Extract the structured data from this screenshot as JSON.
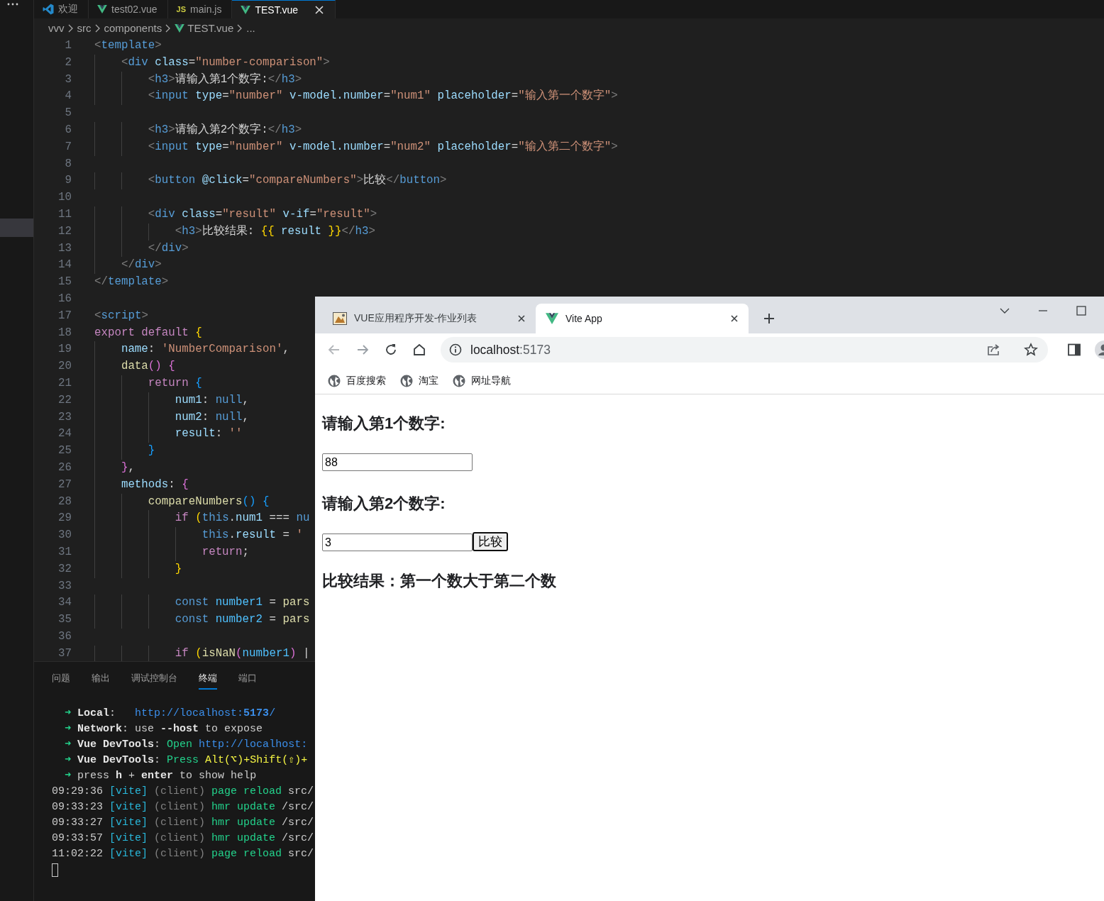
{
  "editor": {
    "tabs": [
      {
        "label": "欢迎",
        "kind": "welcome",
        "selected": false
      },
      {
        "label": "test02.vue",
        "kind": "vue",
        "selected": false
      },
      {
        "label": "main.js",
        "kind": "js",
        "icon_text": "JS",
        "selected": false
      },
      {
        "label": "TEST.vue",
        "kind": "vue",
        "selected": true
      }
    ],
    "breadcrumbs": [
      {
        "label": "vvv",
        "kind": "folder"
      },
      {
        "label": "src",
        "kind": "folder"
      },
      {
        "label": "components",
        "kind": "folder"
      },
      {
        "label": "TEST.vue",
        "kind": "vue"
      },
      {
        "label": "...",
        "kind": "more"
      }
    ],
    "code_lines": [
      {
        "number": "1",
        "tokens": [
          {
            "text": "<",
            "kind": "punct"
          },
          {
            "text": "template",
            "kind": "tag"
          },
          {
            "text": ">",
            "kind": "punct"
          }
        ]
      },
      {
        "number": "2",
        "tokens": [
          {
            "text": "    <",
            "kind": "punct"
          },
          {
            "text": "div",
            "kind": "tag"
          },
          {
            "text": " class",
            "kind": "attr"
          },
          {
            "text": "=",
            "kind": "text"
          },
          {
            "text": "\"number-comparison\"",
            "kind": "string"
          },
          {
            "text": ">",
            "kind": "punct"
          }
        ]
      },
      {
        "number": "3",
        "tokens": [
          {
            "text": "        <",
            "kind": "punct"
          },
          {
            "text": "h3",
            "kind": "tag"
          },
          {
            "text": ">",
            "kind": "punct"
          },
          {
            "text": "请输入第1个数字:",
            "kind": "text"
          },
          {
            "text": "</",
            "kind": "punct"
          },
          {
            "text": "h3",
            "kind": "tag"
          },
          {
            "text": ">",
            "kind": "punct"
          }
        ]
      },
      {
        "number": "4",
        "tokens": [
          {
            "text": "        <",
            "kind": "punct"
          },
          {
            "text": "input",
            "kind": "tag"
          },
          {
            "text": " type",
            "kind": "attr"
          },
          {
            "text": "=",
            "kind": "text"
          },
          {
            "text": "\"number\"",
            "kind": "string"
          },
          {
            "text": " v-model.number",
            "kind": "attr"
          },
          {
            "text": "=",
            "kind": "text"
          },
          {
            "text": "\"num1\"",
            "kind": "string"
          },
          {
            "text": " placeholder",
            "kind": "attr"
          },
          {
            "text": "=",
            "kind": "text"
          },
          {
            "text": "\"输入第一个数字\"",
            "kind": "string"
          },
          {
            "text": ">",
            "kind": "punct"
          }
        ]
      },
      {
        "number": "5"
      },
      {
        "number": "6",
        "tokens": [
          {
            "text": "        <",
            "kind": "punct"
          },
          {
            "text": "h3",
            "kind": "tag"
          },
          {
            "text": ">",
            "kind": "punct"
          },
          {
            "text": "请输入第2个数字:",
            "kind": "text"
          },
          {
            "text": "</",
            "kind": "punct"
          },
          {
            "text": "h3",
            "kind": "tag"
          },
          {
            "text": ">",
            "kind": "punct"
          }
        ]
      },
      {
        "number": "7",
        "tokens": [
          {
            "text": "        <",
            "kind": "punct"
          },
          {
            "text": "input",
            "kind": "tag"
          },
          {
            "text": " type",
            "kind": "attr"
          },
          {
            "text": "=",
            "kind": "text"
          },
          {
            "text": "\"number\"",
            "kind": "string"
          },
          {
            "text": " v-model.number",
            "kind": "attr"
          },
          {
            "text": "=",
            "kind": "text"
          },
          {
            "text": "\"num2\"",
            "kind": "string"
          },
          {
            "text": " placeholder",
            "kind": "attr"
          },
          {
            "text": "=",
            "kind": "text"
          },
          {
            "text": "\"输入第二个数字\"",
            "kind": "string"
          },
          {
            "text": ">",
            "kind": "punct"
          }
        ]
      },
      {
        "number": "8"
      },
      {
        "number": "9",
        "tokens": [
          {
            "text": "        <",
            "kind": "punct"
          },
          {
            "text": "button",
            "kind": "tag"
          },
          {
            "text": " @click",
            "kind": "attr"
          },
          {
            "text": "=",
            "kind": "text"
          },
          {
            "text": "\"compareNumbers\"",
            "kind": "string"
          },
          {
            "text": ">",
            "kind": "punct"
          },
          {
            "text": "比较",
            "kind": "text"
          },
          {
            "text": "</",
            "kind": "punct"
          },
          {
            "text": "button",
            "kind": "tag"
          },
          {
            "text": ">",
            "kind": "punct"
          }
        ]
      },
      {
        "number": "10"
      },
      {
        "number": "11",
        "tokens": [
          {
            "text": "        <",
            "kind": "punct"
          },
          {
            "text": "div",
            "kind": "tag"
          },
          {
            "text": " class",
            "kind": "attr"
          },
          {
            "text": "=",
            "kind": "text"
          },
          {
            "text": "\"result\"",
            "kind": "string"
          },
          {
            "text": " v-if",
            "kind": "attr"
          },
          {
            "text": "=",
            "kind": "text"
          },
          {
            "text": "\"result\"",
            "kind": "string"
          },
          {
            "text": ">",
            "kind": "punct"
          }
        ]
      },
      {
        "number": "12",
        "tokens": [
          {
            "text": "            <",
            "kind": "punct"
          },
          {
            "text": "h3",
            "kind": "tag"
          },
          {
            "text": ">",
            "kind": "punct"
          },
          {
            "text": "比较结果: ",
            "kind": "text"
          },
          {
            "text": "{{",
            "kind": "bracket1"
          },
          {
            "text": " result ",
            "kind": "variable"
          },
          {
            "text": "}}",
            "kind": "bracket1"
          },
          {
            "text": "</",
            "kind": "punct"
          },
          {
            "text": "h3",
            "kind": "tag"
          },
          {
            "text": ">",
            "kind": "punct"
          }
        ]
      },
      {
        "number": "13",
        "tokens": [
          {
            "text": "        </",
            "kind": "punct"
          },
          {
            "text": "div",
            "kind": "tag"
          },
          {
            "text": ">",
            "kind": "punct"
          }
        ]
      },
      {
        "number": "14",
        "tokens": [
          {
            "text": "    </",
            "kind": "punct"
          },
          {
            "text": "div",
            "kind": "tag"
          },
          {
            "text": ">",
            "kind": "punct"
          }
        ]
      },
      {
        "number": "15",
        "tokens": [
          {
            "text": "</",
            "kind": "punct"
          },
          {
            "text": "template",
            "kind": "tag"
          },
          {
            "text": ">",
            "kind": "punct"
          }
        ]
      },
      {
        "number": "16"
      },
      {
        "number": "17",
        "tokens": [
          {
            "text": "<",
            "kind": "punct"
          },
          {
            "text": "script",
            "kind": "tag"
          },
          {
            "text": ">",
            "kind": "punct"
          }
        ]
      },
      {
        "number": "18",
        "tokens": [
          {
            "text": "export default",
            "kind": "control"
          },
          {
            "text": " {",
            "kind": "bracket1"
          }
        ]
      },
      {
        "number": "19",
        "tokens": [
          {
            "text": "    name",
            "kind": "variable"
          },
          {
            "text": ": ",
            "kind": "text"
          },
          {
            "text": "'NumberComparison'",
            "kind": "string"
          },
          {
            "text": ",",
            "kind": "text"
          }
        ]
      },
      {
        "number": "20",
        "tokens": [
          {
            "text": "    data",
            "kind": "function"
          },
          {
            "text": "()",
            "kind": "bracket2"
          },
          {
            "text": " {",
            "kind": "bracket2"
          }
        ]
      },
      {
        "number": "21",
        "tokens": [
          {
            "text": "        return",
            "kind": "control"
          },
          {
            "text": " {",
            "kind": "bracket3"
          }
        ]
      },
      {
        "number": "22",
        "tokens": [
          {
            "text": "            num1",
            "kind": "variable"
          },
          {
            "text": ": ",
            "kind": "text"
          },
          {
            "text": "null",
            "kind": "keyword"
          },
          {
            "text": ",",
            "kind": "text"
          }
        ]
      },
      {
        "number": "23",
        "tokens": [
          {
            "text": "            num2",
            "kind": "variable"
          },
          {
            "text": ": ",
            "kind": "text"
          },
          {
            "text": "null",
            "kind": "keyword"
          },
          {
            "text": ",",
            "kind": "text"
          }
        ]
      },
      {
        "number": "24",
        "tokens": [
          {
            "text": "            result",
            "kind": "variable"
          },
          {
            "text": ": ",
            "kind": "text"
          },
          {
            "text": "''",
            "kind": "string"
          }
        ]
      },
      {
        "number": "25",
        "tokens": [
          {
            "text": "        }",
            "kind": "bracket3"
          }
        ]
      },
      {
        "number": "26",
        "tokens": [
          {
            "text": "    }",
            "kind": "bracket2"
          },
          {
            "text": ",",
            "kind": "text"
          }
        ]
      },
      {
        "number": "27",
        "tokens": [
          {
            "text": "    methods",
            "kind": "variable"
          },
          {
            "text": ": ",
            "kind": "text"
          },
          {
            "text": "{",
            "kind": "bracket2"
          }
        ]
      },
      {
        "number": "28",
        "tokens": [
          {
            "text": "        compareNumbers",
            "kind": "function"
          },
          {
            "text": "()",
            "kind": "bracket3"
          },
          {
            "text": " {",
            "kind": "bracket3"
          }
        ]
      },
      {
        "number": "29",
        "tokens": [
          {
            "text": "            if",
            "kind": "control"
          },
          {
            "text": " (",
            "kind": "bracket1"
          },
          {
            "text": "this",
            "kind": "keyword"
          },
          {
            "text": ".",
            "kind": "text"
          },
          {
            "text": "num1",
            "kind": "variable"
          },
          {
            "text": " === ",
            "kind": "text"
          },
          {
            "text": "nu",
            "kind": "keyword"
          }
        ]
      },
      {
        "number": "30",
        "tokens": [
          {
            "text": "                this",
            "kind": "keyword"
          },
          {
            "text": ".",
            "kind": "text"
          },
          {
            "text": "result",
            "kind": "variable"
          },
          {
            "text": " = ",
            "kind": "text"
          },
          {
            "text": "'",
            "kind": "string"
          }
        ]
      },
      {
        "number": "31",
        "tokens": [
          {
            "text": "                return",
            "kind": "control"
          },
          {
            "text": ";",
            "kind": "text"
          }
        ]
      },
      {
        "number": "32",
        "tokens": [
          {
            "text": "            }",
            "kind": "bracket1"
          }
        ]
      },
      {
        "number": "33"
      },
      {
        "number": "34",
        "tokens": [
          {
            "text": "            const",
            "kind": "keyword"
          },
          {
            "text": " number1",
            "kind": "constant"
          },
          {
            "text": " = ",
            "kind": "text"
          },
          {
            "text": "pars",
            "kind": "function"
          }
        ]
      },
      {
        "number": "35",
        "tokens": [
          {
            "text": "            const",
            "kind": "keyword"
          },
          {
            "text": " number2",
            "kind": "constant"
          },
          {
            "text": " = ",
            "kind": "text"
          },
          {
            "text": "pars",
            "kind": "function"
          }
        ]
      },
      {
        "number": "36"
      },
      {
        "number": "37",
        "tokens": [
          {
            "text": "            if",
            "kind": "control"
          },
          {
            "text": " (",
            "kind": "bracket1"
          },
          {
            "text": "isNaN",
            "kind": "function"
          },
          {
            "text": "(",
            "kind": "bracket2"
          },
          {
            "text": "number1",
            "kind": "constant"
          },
          {
            "text": ")",
            "kind": "bracket2"
          },
          {
            "text": " |",
            "kind": "text"
          }
        ]
      }
    ],
    "panel": {
      "tabs": [
        {
          "label": "问题",
          "selected": false
        },
        {
          "label": "输出",
          "selected": false
        },
        {
          "label": "调试控制台",
          "selected": false
        },
        {
          "label": "终端",
          "selected": true
        },
        {
          "label": "端口",
          "selected": false
        }
      ],
      "terminal_lines": [
        {
          "tokens": [
            {
              "text": "  ➜ ",
              "kind": "arrow"
            },
            {
              "text": "Local",
              "kind": "bold"
            },
            {
              "text": ":   ",
              "kind": "text"
            },
            {
              "text": "http://localhost:",
              "kind": "link"
            },
            {
              "text": "5173",
              "kind": "linkbold"
            },
            {
              "text": "/",
              "kind": "link"
            }
          ]
        },
        {
          "tokens": [
            {
              "text": "  ➜ ",
              "kind": "arrow"
            },
            {
              "text": "Network",
              "kind": "bold"
            },
            {
              "text": ": use ",
              "kind": "text"
            },
            {
              "text": "--host",
              "kind": "bold"
            },
            {
              "text": " to expose",
              "kind": "text"
            }
          ]
        },
        {
          "tokens": [
            {
              "text": "  ➜ ",
              "kind": "arrow"
            },
            {
              "text": "Vue DevTools",
              "kind": "bold"
            },
            {
              "text": ": ",
              "kind": "text"
            },
            {
              "text": "Open ",
              "kind": "green"
            },
            {
              "text": "http://localhost:",
              "kind": "link"
            }
          ]
        },
        {
          "tokens": [
            {
              "text": "  ➜ ",
              "kind": "arrow"
            },
            {
              "text": "Vue DevTools",
              "kind": "bold"
            },
            {
              "text": ": ",
              "kind": "text"
            },
            {
              "text": "Press ",
              "kind": "green"
            },
            {
              "text": "Alt(⌥)+Shift(⇧)+",
              "kind": "yellow"
            }
          ]
        },
        {
          "tokens": [
            {
              "text": "  ➜ ",
              "kind": "arrow"
            },
            {
              "text": "press ",
              "kind": "text"
            },
            {
              "text": "h",
              "kind": "bold"
            },
            {
              "text": " + ",
              "kind": "text"
            },
            {
              "text": "enter",
              "kind": "bold"
            },
            {
              "text": " to show help",
              "kind": "text"
            }
          ]
        },
        {
          "tokens": [
            {
              "text": "09:29:36 ",
              "kind": "text"
            },
            {
              "text": "[vite]",
              "kind": "cyan"
            },
            {
              "text": " (client)",
              "kind": "dim"
            },
            {
              "text": " page reload",
              "kind": "green"
            },
            {
              "text": " src/",
              "kind": "text"
            }
          ]
        },
        {
          "tokens": [
            {
              "text": "09:33:23 ",
              "kind": "text"
            },
            {
              "text": "[vite]",
              "kind": "cyan"
            },
            {
              "text": " (client)",
              "kind": "dim"
            },
            {
              "text": " hmr update",
              "kind": "green"
            },
            {
              "text": " /src/",
              "kind": "text"
            }
          ]
        },
        {
          "tokens": [
            {
              "text": "09:33:27 ",
              "kind": "text"
            },
            {
              "text": "[vite]",
              "kind": "cyan"
            },
            {
              "text": " (client)",
              "kind": "dim"
            },
            {
              "text": " hmr update",
              "kind": "green"
            },
            {
              "text": " /src/",
              "kind": "text"
            }
          ]
        },
        {
          "tokens": [
            {
              "text": "09:33:57 ",
              "kind": "text"
            },
            {
              "text": "[vite]",
              "kind": "cyan"
            },
            {
              "text": " (client)",
              "kind": "dim"
            },
            {
              "text": " hmr update",
              "kind": "green"
            },
            {
              "text": " /src/",
              "kind": "text"
            }
          ]
        },
        {
          "tokens": [
            {
              "text": "11:02:22 ",
              "kind": "text"
            },
            {
              "text": "[vite]",
              "kind": "cyan"
            },
            {
              "text": " (client)",
              "kind": "dim"
            },
            {
              "text": " page reload",
              "kind": "green"
            },
            {
              "text": " src/",
              "kind": "text"
            }
          ]
        }
      ]
    }
  },
  "browser": {
    "tabs": [
      {
        "title": "VUE应用程序开发-作业列表",
        "kind": "picture",
        "selected": false
      },
      {
        "title": "Vite App",
        "kind": "vue",
        "selected": true
      }
    ],
    "address": {
      "host": "localhost",
      "port": ":5173"
    },
    "bookmarks": [
      {
        "label": "百度搜索"
      },
      {
        "label": "淘宝"
      },
      {
        "label": "网址导航"
      }
    ],
    "page": {
      "fields": [
        {
          "label": "请输入第1个数字:",
          "value": "88"
        },
        {
          "label": "请输入第2个数字:",
          "value": "3"
        }
      ],
      "button": "比较",
      "result": "比较结果：第一个数大于第二个数"
    }
  }
}
